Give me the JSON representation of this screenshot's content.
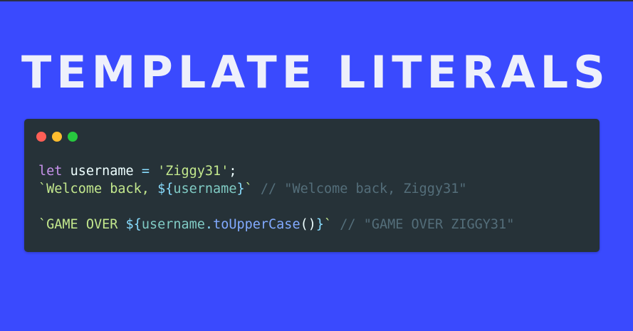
{
  "title": "TEMPLATE LITERALS",
  "colors": {
    "background": "#3a4afe",
    "code_background": "#263238",
    "dot_red": "#ff5f56",
    "dot_yellow": "#ffbd2e",
    "dot_green": "#27c93f"
  },
  "code": {
    "line1": {
      "keyword": "let",
      "variable": "username",
      "operator": "=",
      "string": "'Ziggy31'",
      "end": ";"
    },
    "line2": {
      "tick_open": "`",
      "text": "Welcome back, ",
      "interp_open": "${",
      "variable": "username",
      "interp_close": "}",
      "tick_close": "`",
      "comment": "// \"Welcome back, Ziggy31\""
    },
    "line4": {
      "tick_open": "`",
      "text": "GAME OVER ",
      "interp_open": "${",
      "variable": "username",
      "dot": ".",
      "method": "toUpperCase",
      "parens": "()",
      "interp_close": "}",
      "tick_close": "`",
      "comment": "// \"GAME OVER ZIGGY31\""
    }
  }
}
